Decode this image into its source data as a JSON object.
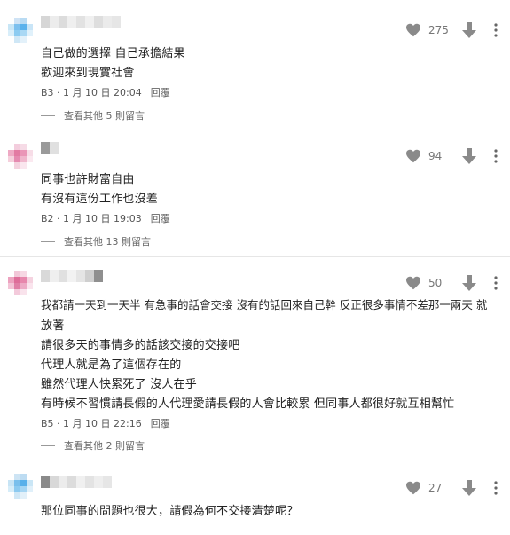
{
  "comments": [
    {
      "likes": "275",
      "lines": [
        "自己做的選擇 自己承擔結果",
        "歡迎來到現實社會"
      ],
      "meta": "B3 · 1 月 10 日 20:04",
      "reply_label": "回覆",
      "more_replies": "查看其他 5 則留言"
    },
    {
      "likes": "94",
      "lines": [
        "同事也許財富自由",
        "有沒有這份工作也沒差"
      ],
      "meta": "B2 · 1 月 10 日 19:03",
      "reply_label": "回覆",
      "more_replies": "查看其他 13 則留言"
    },
    {
      "likes": "50",
      "lines": [
        "我都請一天到一天半 有急事的話會交接 沒有的話回來自己幹 反正很多事情不差那一兩天 就",
        "放著",
        "請很多天的事情多的話該交接的交接吧",
        "代理人就是為了這個存在的",
        "雖然代理人快累死了 沒人在乎",
        "有時候不習慣請長假的人代理愛請長假的人會比較累 但同事人都很好就互相幫忙"
      ],
      "meta": "B5 · 1 月 10 日 22:16",
      "reply_label": "回覆",
      "more_replies": "查看其他 2 則留言"
    },
    {
      "likes": "27",
      "lines": [
        "那位同事的問題也很大，請假為何不交接清楚呢？"
      ]
    }
  ],
  "icons": {
    "like": "heart-icon",
    "downvote": "arrow-down-icon",
    "more": "more-vertical-icon"
  },
  "colors": {
    "icon_gray": "#8a8a8a",
    "separator": "#e6e6e6"
  }
}
